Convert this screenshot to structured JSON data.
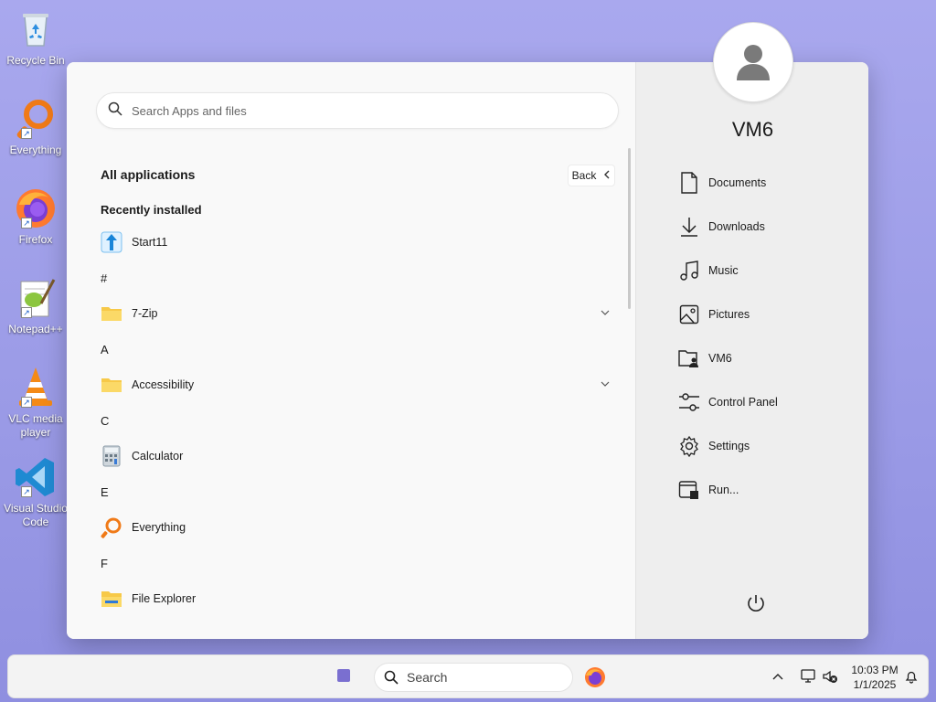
{
  "desktop": {
    "icons": [
      {
        "label": "Recycle Bin"
      },
      {
        "label": "Everything"
      },
      {
        "label": "Firefox"
      },
      {
        "label": "Notepad++"
      },
      {
        "label": "VLC media player"
      },
      {
        "label": "Visual Studio Code"
      }
    ]
  },
  "start_menu": {
    "search_placeholder": "Search Apps and files",
    "all_apps_title": "All applications",
    "back_label": "Back",
    "recently_installed": "Recently installed",
    "apps": {
      "start11": "Start11",
      "hash": "#",
      "seven_zip": "7-Zip",
      "letter_a": "A",
      "accessibility": "Accessibility",
      "letter_c": "C",
      "calculator": "Calculator",
      "letter_e": "E",
      "everything": "Everything",
      "letter_f": "F",
      "file_explorer": "File Explorer"
    },
    "user_name": "VM6",
    "quick_links": {
      "documents": "Documents",
      "downloads": "Downloads",
      "music": "Music",
      "pictures": "Pictures",
      "vm6": "VM6",
      "control_panel": "Control Panel",
      "settings": "Settings",
      "run": "Run..."
    }
  },
  "taskbar": {
    "search_label": "Search",
    "time": "10:03 PM",
    "date": "1/1/2025"
  },
  "colors": {
    "desktop_bg": "#a9a8ee",
    "start_accent": "#7a6fd0"
  }
}
